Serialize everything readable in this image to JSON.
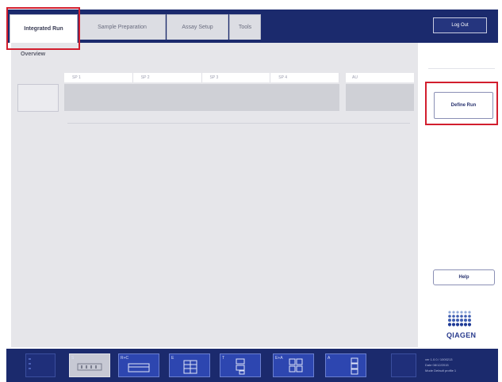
{
  "tabs": [
    {
      "label": "Integrated Run",
      "active": true
    },
    {
      "label": "Sample Preparation",
      "active": false
    },
    {
      "label": "Assay Setup",
      "active": false
    },
    {
      "label": "Tools",
      "active": false
    }
  ],
  "header": {
    "logout_label": "Log Out"
  },
  "overview": {
    "title": "Overview",
    "sp_columns": [
      "SP 1",
      "SP 2",
      "SP 3",
      "SP 4"
    ],
    "au_column": "AU"
  },
  "side": {
    "define_run_label": "Define Run",
    "help_label": "Help",
    "logo_text": "QIAGEN"
  },
  "bottom": {
    "icons": [
      {
        "name": "waste-drawer-icon",
        "label": ""
      },
      {
        "name": "sample-drawer-icon",
        "label": "S"
      },
      {
        "name": "reagents-drawer-icon",
        "label": "R+C"
      },
      {
        "name": "eluate-drawer-icon",
        "label": "E"
      },
      {
        "name": "consumables-icon",
        "label": "T"
      },
      {
        "name": "assay-drawer-icon",
        "label": "E+A"
      },
      {
        "name": "assay-tubes-icon",
        "label": "A"
      }
    ],
    "status_lines": [
      "ver 1.0.0 / 1000213",
      "Date    08/12/2015",
      "Mode    Default profile 1"
    ]
  },
  "colors": {
    "navy": "#1b2a6d",
    "panel": "#e6e6ea",
    "highlight": "#d21e2e",
    "logo": "#2a3c8e"
  }
}
